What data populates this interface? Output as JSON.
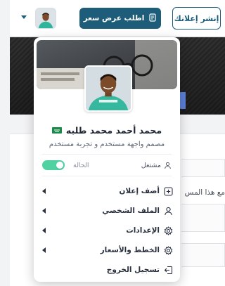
{
  "header": {
    "publish_label": "إنشر إعلانك",
    "quote_label": "اطلب عرض سعر"
  },
  "background": {
    "partial_text": "مع هذا المس"
  },
  "menu": {
    "user_name": "محمد أحمد محمد طلبه",
    "user_title": "مصمم واجهة مستخدم و تجربة مستخدم",
    "work_status": "مشتغل",
    "status_label": "الحالة",
    "status_on": true,
    "items": [
      {
        "label": "أضف إعلان",
        "icon": "plus-square-icon"
      },
      {
        "label": "الملف الشخصي",
        "icon": "user-icon"
      },
      {
        "label": "الإعدادات",
        "icon": "gear-icon"
      },
      {
        "label": "الخطط والأسعار",
        "icon": "gear-icon"
      },
      {
        "label": "تسجيل الخروج",
        "icon": "logout-icon"
      }
    ]
  },
  "colors": {
    "primary": "#1d5d7a",
    "toggle_on": "#4fd1a1",
    "accent_blue": "#5b7fd6"
  }
}
